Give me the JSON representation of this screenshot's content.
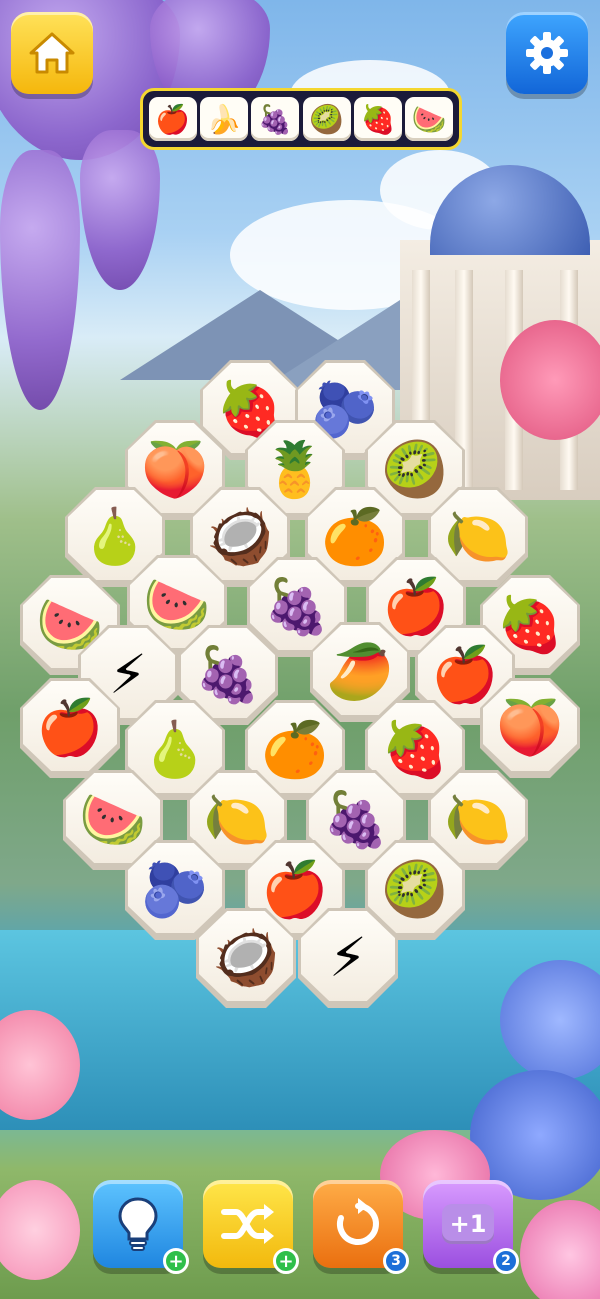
{
  "topbar": {
    "home_icon": "house-icon",
    "settings_icon": "gear-icon"
  },
  "collection_bar": {
    "slots": [
      "🍎",
      "🍌",
      "🍇",
      "🥝",
      "🍓",
      "🍉"
    ]
  },
  "board": {
    "tiles": [
      "🍓",
      "🫐",
      "🍑",
      "🍍",
      "🥝",
      "🍐",
      "🥥",
      "🍊",
      "🍋",
      "🍉",
      "🍉",
      "🍇",
      "🍎",
      "🍓",
      "⚡",
      "🍇",
      "🥭",
      "🍎",
      "🍎",
      "🍐",
      "🍊",
      "🍓",
      "🍑",
      "🍉",
      "🍋",
      "🍇",
      "🍋",
      "🫐",
      "🍎",
      "🥝",
      "🥥",
      "⚡"
    ]
  },
  "boosters": {
    "hint": {
      "icon": "lightbulb-icon",
      "badge": "+"
    },
    "shuffle": {
      "icon": "shuffle-icon",
      "badge": "+"
    },
    "undo": {
      "icon": "undo-icon",
      "badge": "3"
    },
    "extra_slot": {
      "label": "+1",
      "badge": "2"
    }
  },
  "colors": {
    "home_button": "#f5b70c",
    "settings_button": "#1266d8",
    "collection_border": "#f4d730",
    "badge_green": "#2fbf4a",
    "badge_blue": "#1d6fd8"
  }
}
